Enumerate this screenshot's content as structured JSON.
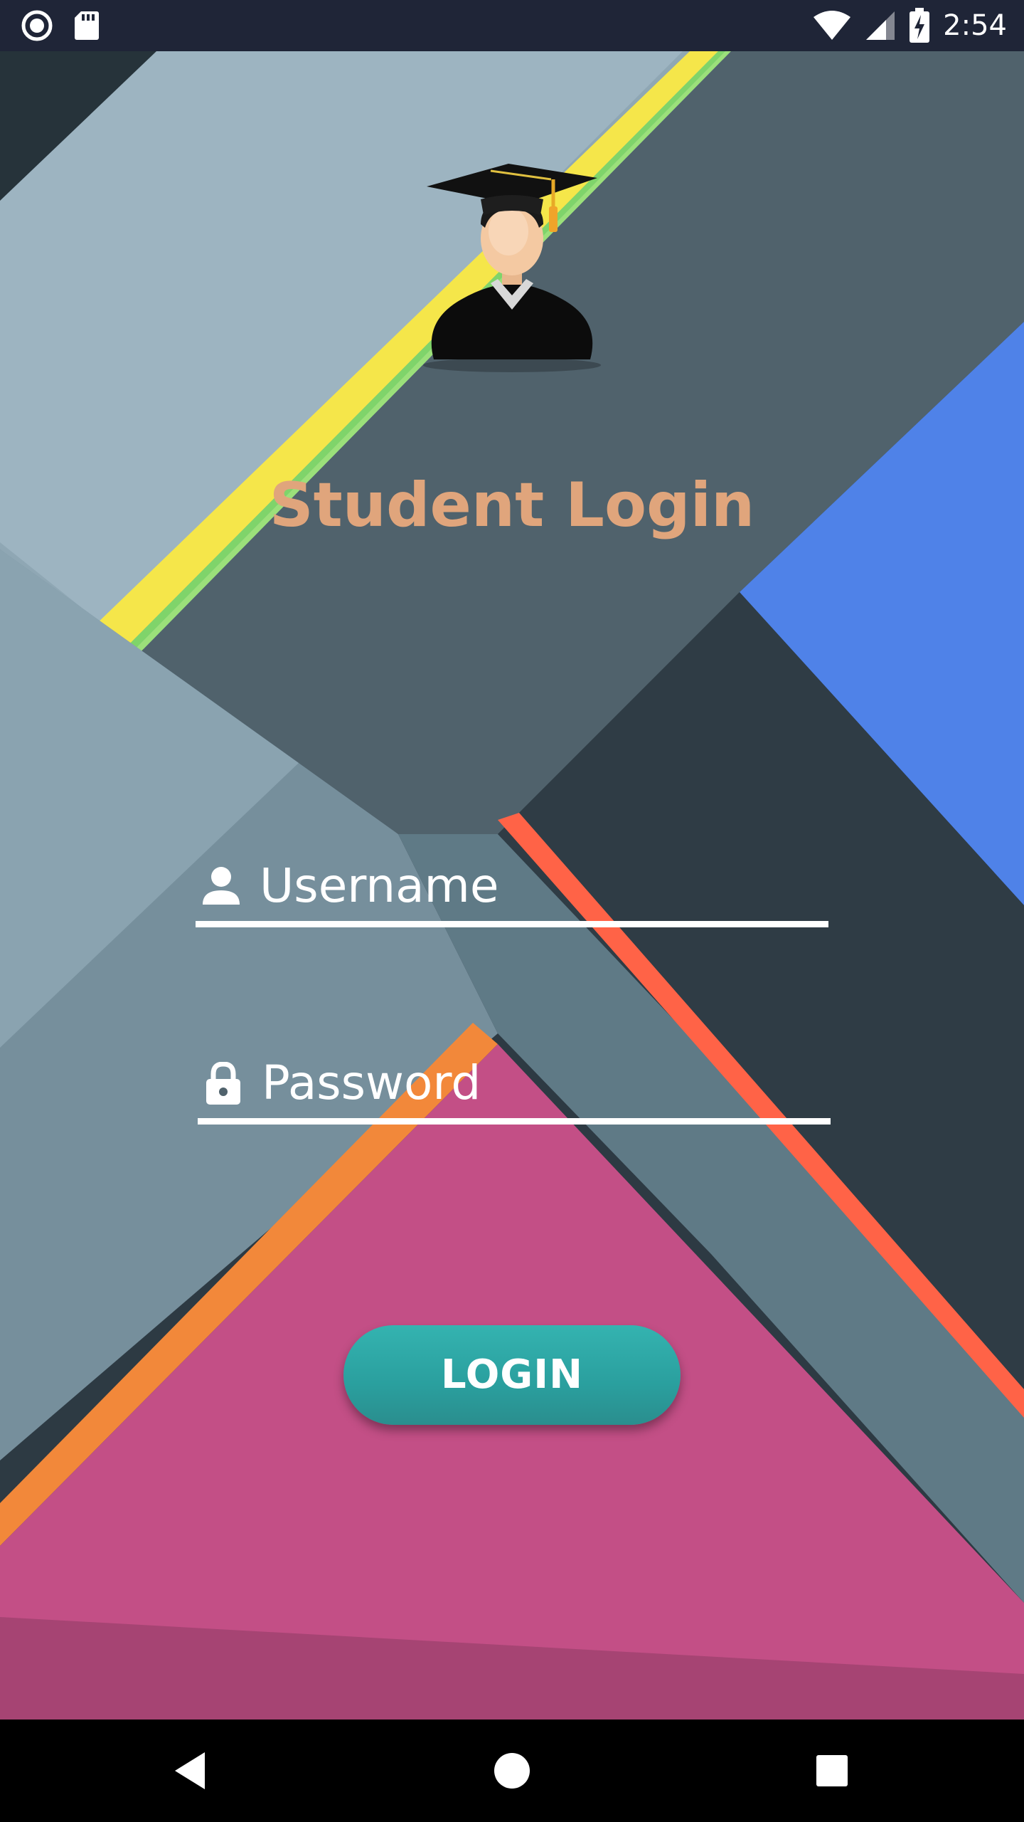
{
  "status_bar": {
    "time": "2:54",
    "left_icons": [
      "record-icon",
      "sd-card-icon"
    ],
    "right_icons": [
      "wifi-icon",
      "signal-icon",
      "battery-charging-icon"
    ]
  },
  "app": {
    "title": "Student Login",
    "logo_icon": "graduate-icon",
    "username": {
      "icon": "person-icon",
      "placeholder": "Username"
    },
    "password": {
      "icon": "lock-icon",
      "placeholder": "Password"
    },
    "login_label": "LOGIN"
  },
  "nav_bar": {
    "buttons": [
      "back-icon",
      "home-icon",
      "recents-icon"
    ]
  },
  "colors": {
    "title": "#e0a57c",
    "button": "#2fa8a7",
    "status_bar": "#1f2537",
    "nav_bar": "#000000"
  }
}
